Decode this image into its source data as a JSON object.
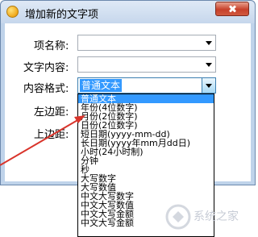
{
  "window": {
    "title": "增加新的文字项",
    "close_icon": "close-icon",
    "app_icon": "app-icon"
  },
  "form": {
    "name_label": "项名称:",
    "content_label": "文字内容:",
    "format_label": "内容格式:",
    "left_margin_label": "左边距:",
    "top_margin_label": "上边距:",
    "name_value": "",
    "content_value": "",
    "format_value": "普通文本"
  },
  "format_options": [
    "普通文本",
    "年份(4位数字)",
    "月份(2位数字)",
    "日份(2位数字)",
    "短日期(yyyy-mm-dd)",
    "长日期(yyyy年mm月dd日)",
    "小时(24小时制)",
    "分钟",
    "秒",
    "大写数字",
    "大写数值",
    "中文大写数字",
    "中文大写数值",
    "中文大写金额",
    "中文大写金额"
  ],
  "watermark": {
    "text": "系统之家"
  },
  "colors": {
    "selection": "#3399ff",
    "annotation_arrow": "#d9342b",
    "dialog_frame": "#bfd3ea"
  }
}
